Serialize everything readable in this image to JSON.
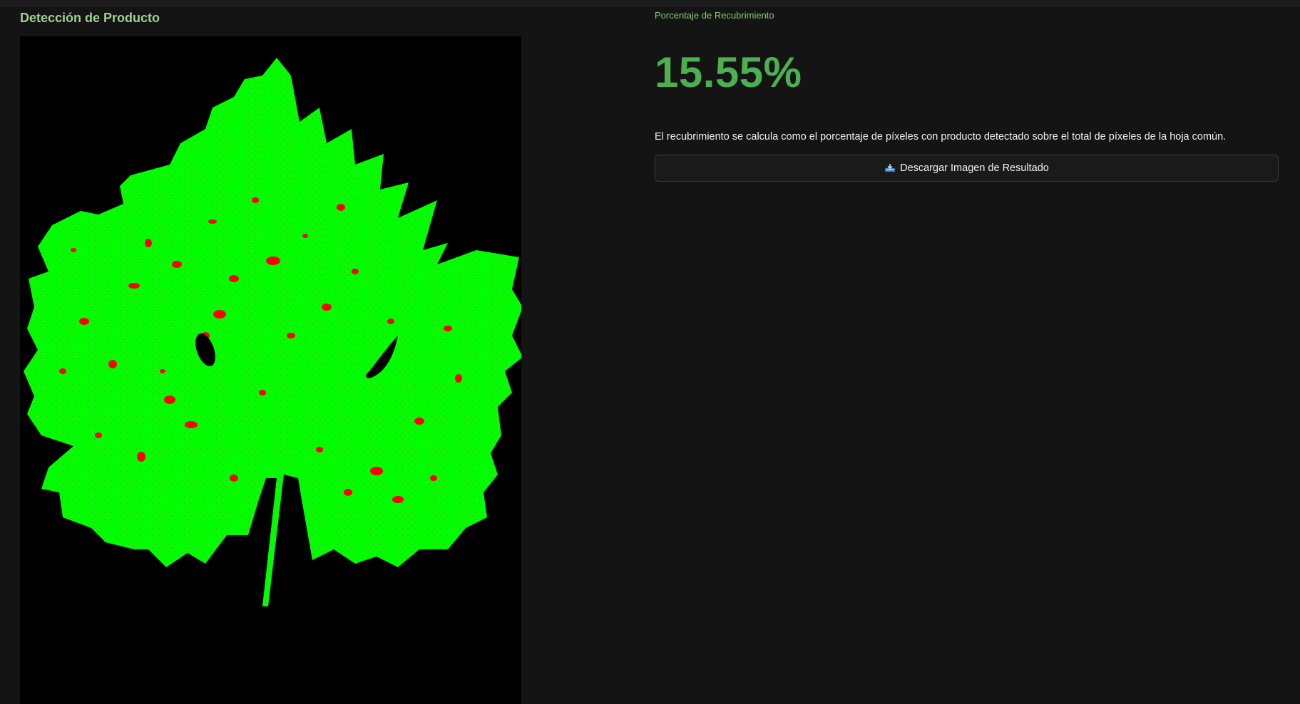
{
  "left": {
    "title": "Detección de Producto",
    "image_alt": "leaf-detection-result-image"
  },
  "right": {
    "metric_label": "Porcentaje de Recubrimiento",
    "metric_value": "15.55%",
    "description": "El recubrimiento se calcula como el porcentaje de píxeles con producto detectado sobre el total de píxeles de la hoja común.",
    "download_button": {
      "icon": "inbox-tray-icon",
      "label": "Descargar Imagen de Resultado"
    }
  },
  "colors": {
    "background": "#141414",
    "title": "#9fd08f",
    "metric_value": "#4caf50",
    "leaf_green": "#00ff00",
    "product_red": "#ff0000"
  }
}
